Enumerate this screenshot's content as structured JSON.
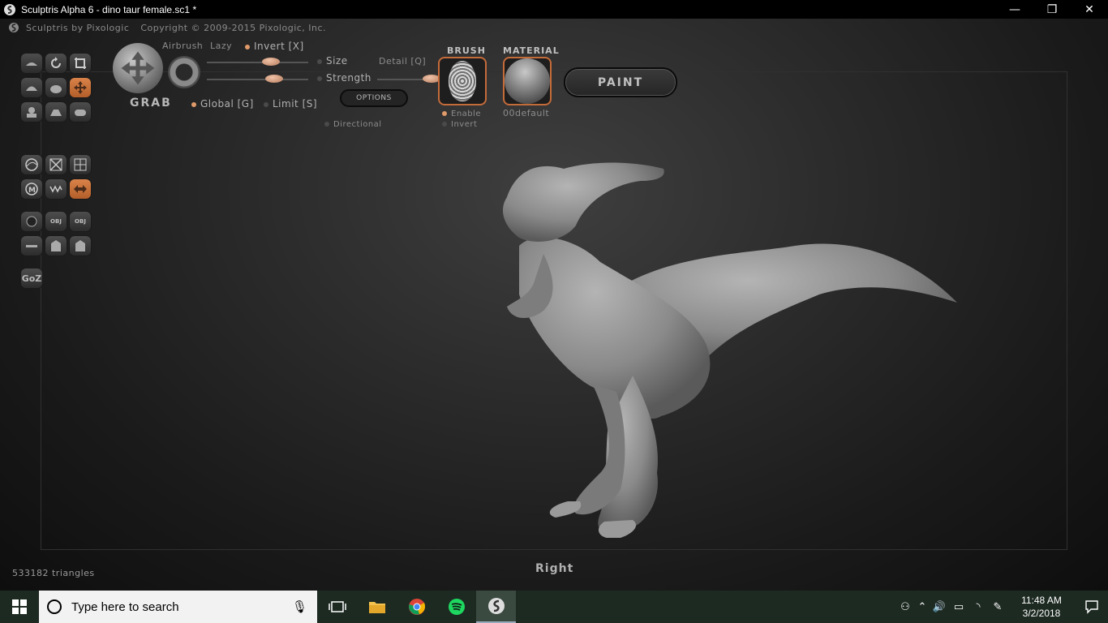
{
  "window": {
    "title": "Sculptris Alpha 6 - dino taur female.sc1 *",
    "minimize": "—",
    "maximize": "❐",
    "close": "✕"
  },
  "app": {
    "brand": "Sculptris by Pixologic",
    "copyright": "Copyright © 2009-2015 Pixologic, Inc."
  },
  "tools": {
    "current_tool": "GRAB",
    "goz": "GoZ",
    "obj_import": "OBJ",
    "obj_export": "OBJ"
  },
  "brush_panel": {
    "airbrush": "Airbrush",
    "lazy": "Lazy",
    "invert": "Invert [X]",
    "size": "Size",
    "detail": "Detail [Q]",
    "strength": "Strength",
    "global": "Global [G]",
    "limit": "Limit [S]",
    "options": "OPTIONS",
    "directional": "Directional",
    "brush_title": "BRUSH",
    "brush_enable": "Enable",
    "brush_invert": "Invert",
    "material_title": "MATERIAL",
    "material_name": "00default",
    "paint": "PAINT",
    "size_value": 0.63,
    "strength_value": 0.66,
    "detail_value": 0.95
  },
  "status": {
    "view": "Right",
    "triangles": "533182 triangles"
  },
  "taskbar": {
    "search_placeholder": "Type here to search",
    "time": "11:48 AM",
    "date": "3/2/2018"
  }
}
